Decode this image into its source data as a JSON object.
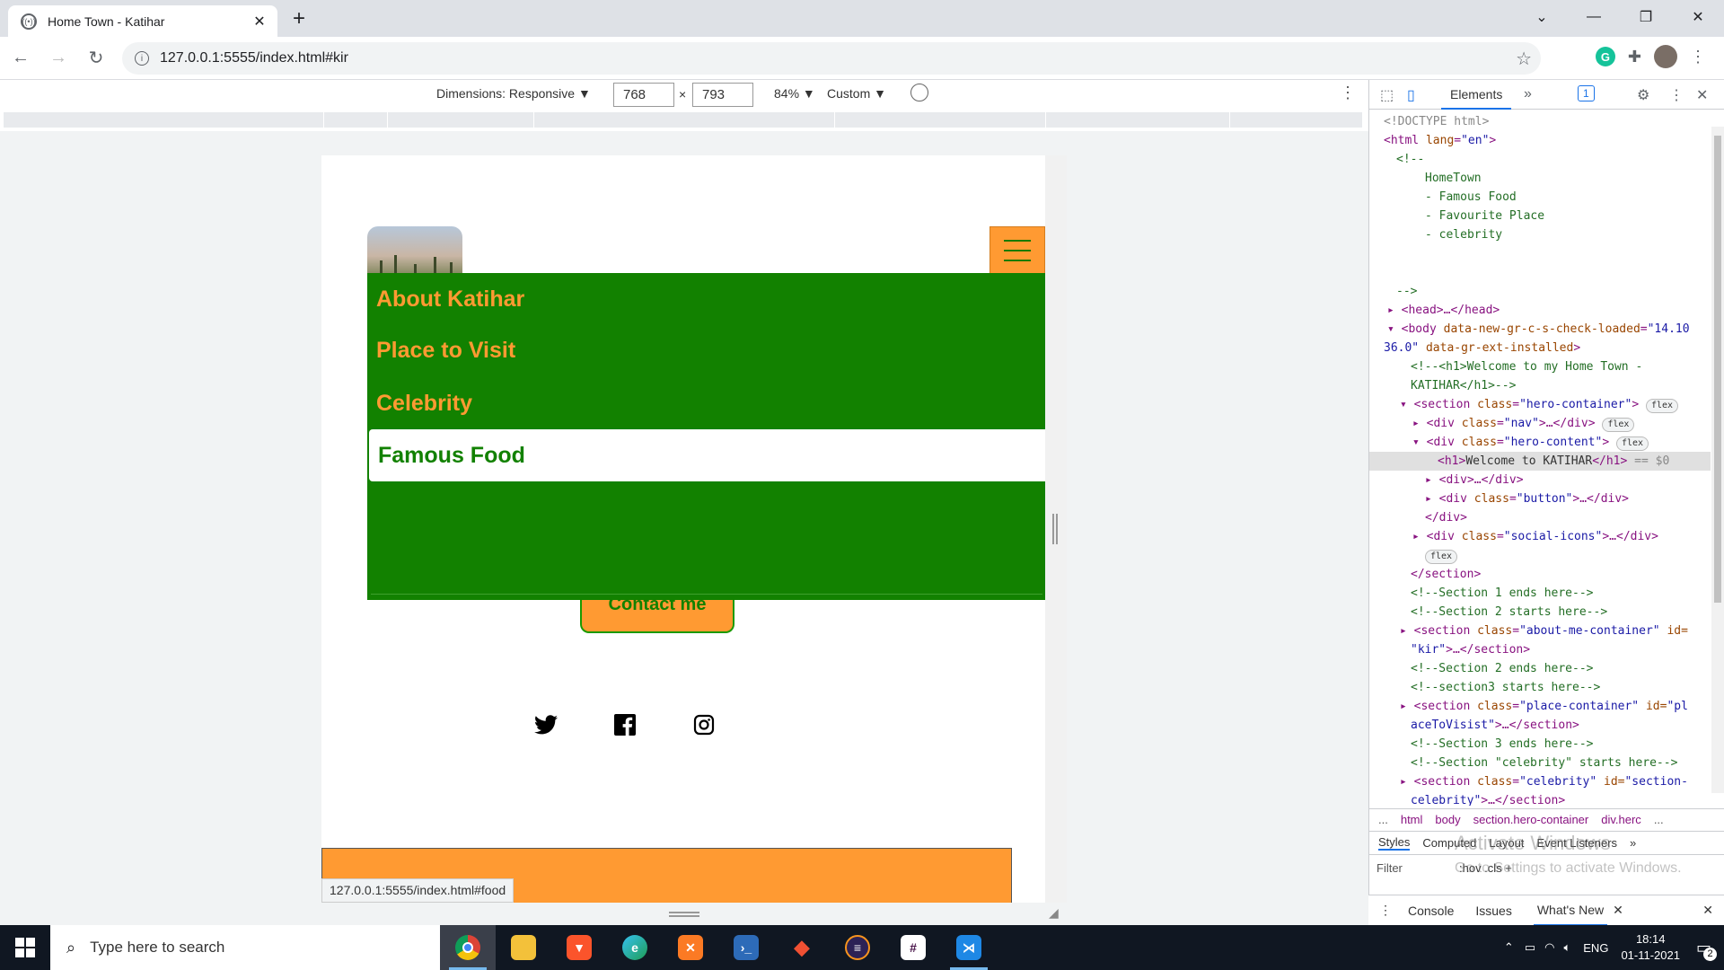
{
  "browser": {
    "tab_title": "Home Town - Katihar",
    "new_tab": "+",
    "tab_close": "✕",
    "url": "127.0.0.1:5555/index.html#kir",
    "controls": {
      "minimize": "—",
      "restore": "❐",
      "close": "✕",
      "tabs_menu": "⌄"
    }
  },
  "device_toolbar": {
    "dimensions_label": "Dimensions: Responsive ▼",
    "width": "768",
    "times": "×",
    "height": "793",
    "zoom": "84% ▼",
    "throttle": "Custom ▼"
  },
  "page": {
    "menu": [
      {
        "label": "About Katihar",
        "active": false
      },
      {
        "label": "Place to Visit",
        "active": false
      },
      {
        "label": "Celebrity",
        "active": false
      },
      {
        "label": "Famous Food",
        "active": true
      }
    ],
    "contact_button": "Contact me",
    "social_icons": [
      "twitter-icon",
      "facebook-icon",
      "instagram-icon"
    ],
    "status_url": "127.0.0.1:5555/index.html#food",
    "colors": {
      "menu_bg": "#128100",
      "accent": "#ff9a32"
    }
  },
  "devtools": {
    "tab_elements": "Elements",
    "more_tabs": "»",
    "issues_badge": "1",
    "breadcrumbs": [
      "...",
      "html",
      "body",
      "section.hero-container",
      "div.herc",
      "..."
    ],
    "subtabs": [
      "Styles",
      "Computed",
      "Layout",
      "Event Listeners",
      "»"
    ],
    "filter": "Filter",
    "filter_tools": ":hov  .cls  +",
    "drawer_tabs": [
      "Console",
      "Issues",
      "What's New"
    ],
    "watermark_title": "Activate Windows",
    "watermark_sub": "Go to Settings to activate Windows.",
    "dom": {
      "l1": "<!DOCTYPE html>",
      "l2_tag": "<html ",
      "l2_attr": "lang",
      "l2_val": "\"en\"",
      "l2_end": ">",
      "l3": "<!--",
      "l4": "HomeTown",
      "l5": "- Famous Food",
      "l6": "- Favourite Place",
      "l7": "- celebrity",
      "l8": "-->",
      "l9": "<head>…</head>",
      "l10_tag": "<body ",
      "l10_attr": "data-new-gr-c-s-check-loaded",
      "l10_val": "\"14.10",
      "l11_val": "36.0\"",
      "l11_attr": "data-gr-ext-installed",
      "l11_end": ">",
      "l12": "<!--<h1>Welcome to my Home Town -",
      "l13": "KATIHAR</h1>-->",
      "l14_tag": "<section ",
      "l14_attr": "class",
      "l14_val": "\"hero-container\"",
      "l14_end": ">",
      "l15_tag": "<div ",
      "l15_attr": "class",
      "l15_val": "\"nav\"",
      "l15_end": ">…</div>",
      "l16_tag": "<div ",
      "l16_attr": "class",
      "l16_val": "\"hero-content\"",
      "l16_end": ">",
      "l17_open": "<h1>",
      "l17_text": "Welcome to KATIHAR",
      "l17_close": "</h1>",
      "l17_ref": " == $0",
      "l18": "<div>…</div>",
      "l19_tag": "<div ",
      "l19_attr": "class",
      "l19_val": "\"button\"",
      "l19_end": ">…</div>",
      "l20": "</div>",
      "l21_tag": "<div ",
      "l21_attr": "class",
      "l21_val": "\"social-icons\"",
      "l21_end": ">…</div>",
      "l22": "</section>",
      "l23": "<!--Section 1 ends here-->",
      "l24": "<!--Section 2 starts here-->",
      "l25_tag": "<section ",
      "l25_attr": "class",
      "l25_val": "\"about-me-container\"",
      "l25_attr2": "id=",
      "l26_val": "\"kir\"",
      "l26_end": ">…</section>",
      "l27": "<!--Section 2 ends here-->",
      "l28": "<!--section3 starts here-->",
      "l29_tag": "<section ",
      "l29_attr": "class",
      "l29_val": "\"place-container\"",
      "l29_attr2": "id=",
      "l29_val2": "\"pl",
      "l30_val": "aceToVisist\"",
      "l30_end": ">…</section>",
      "l31": "<!--Section 3 ends here-->",
      "l32": "<!--Section \"celebrity\" starts here-->",
      "l33_tag": "<section ",
      "l33_attr": "class",
      "l33_val": "\"celebrity\"",
      "l33_attr2": "id=",
      "l33_val2": "\"section-",
      "l34_val": "celebrity\"",
      "l34_end": ">…</section>",
      "pill_flex": "flex"
    }
  },
  "taskbar": {
    "search_placeholder": "Type here to search",
    "lang": "ENG",
    "time": "18:14",
    "date": "01-11-2021",
    "notifications": "2"
  }
}
